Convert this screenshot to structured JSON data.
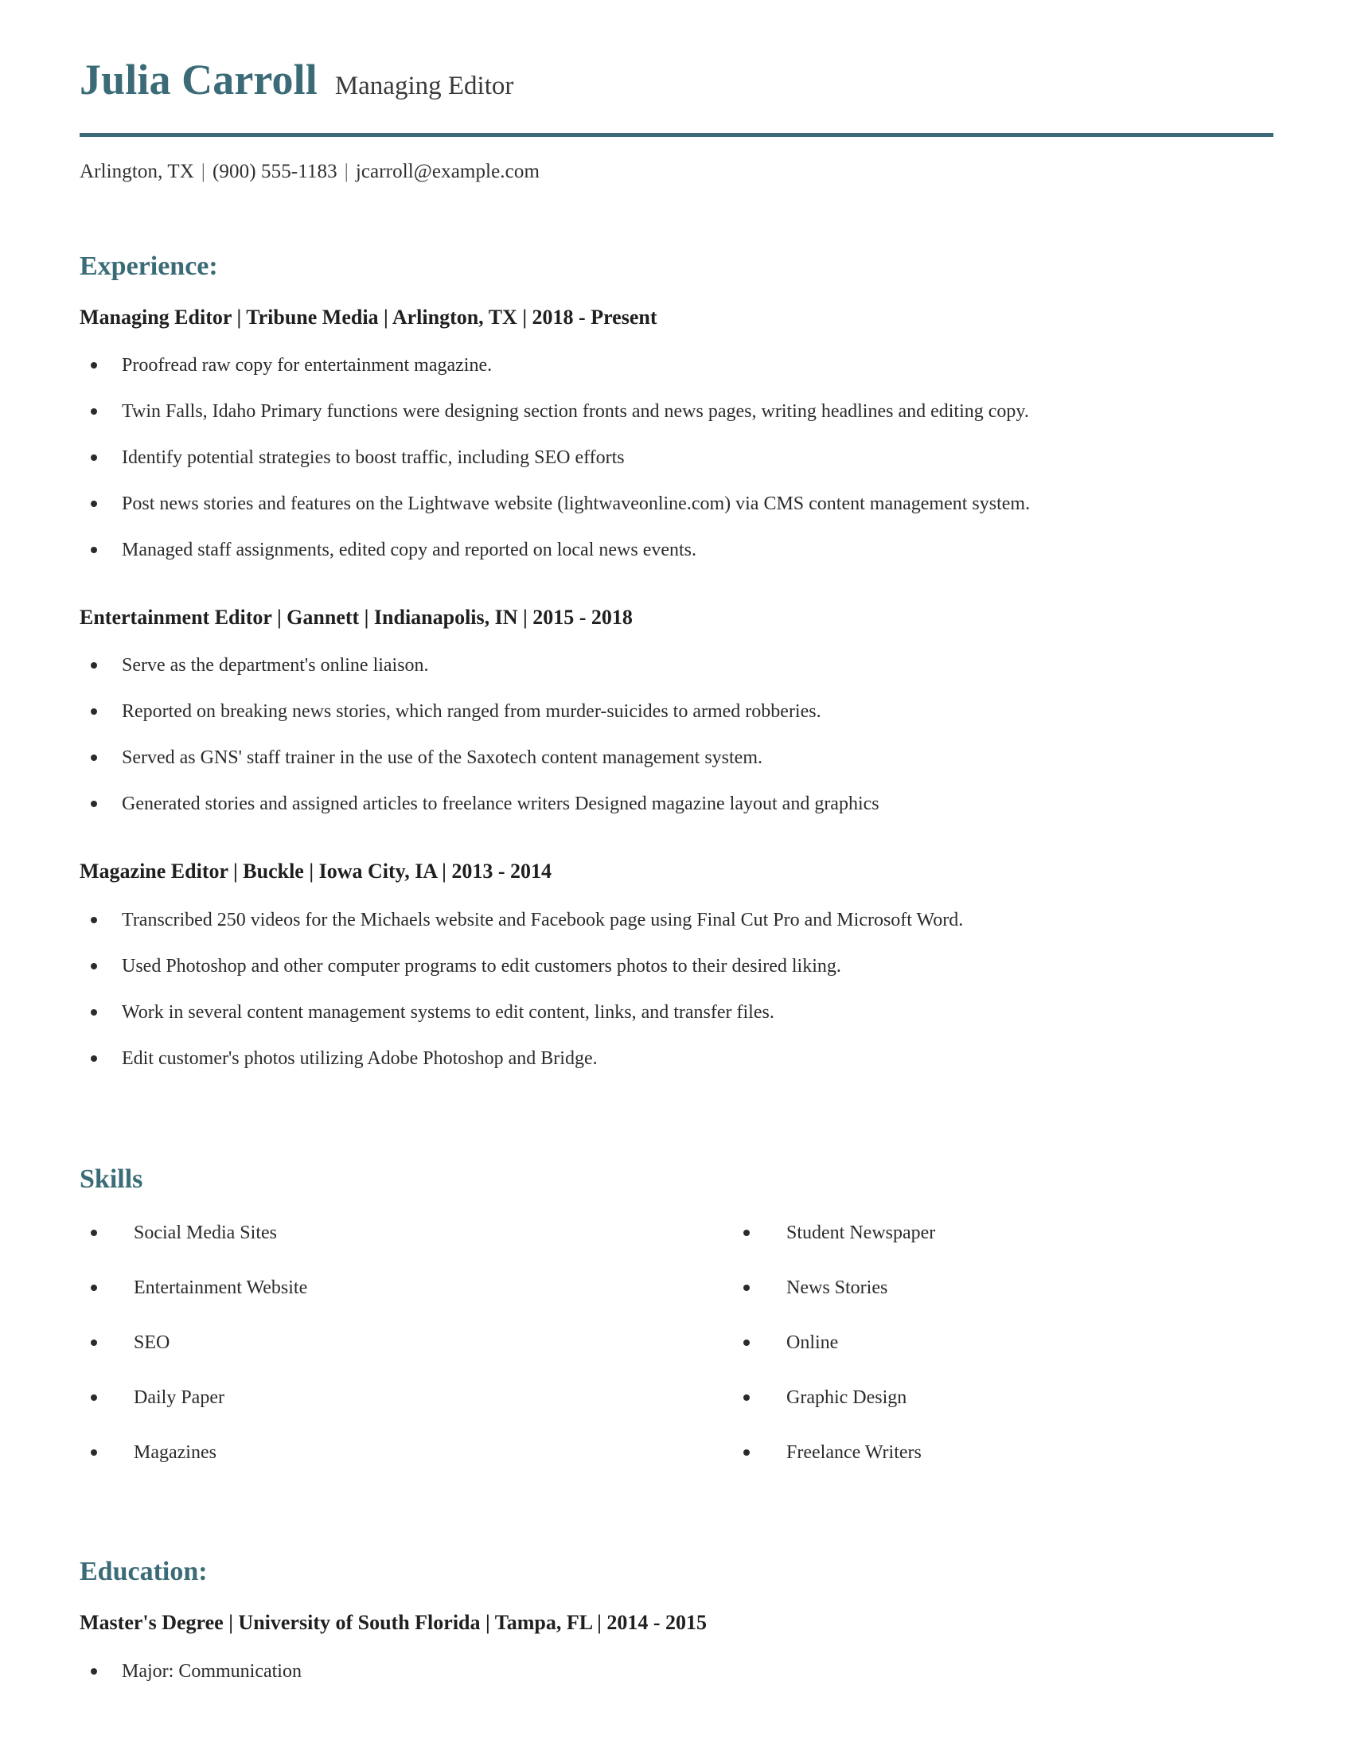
{
  "colors": {
    "accent": "#3a6b77",
    "text": "#2b2b2b",
    "heading_text": "#1f1f1f"
  },
  "header": {
    "name": "Julia Carroll",
    "job_title": "Managing Editor",
    "contact": {
      "location": "Arlington, TX",
      "phone": "(900) 555-1183",
      "email": "jcarroll@example.com",
      "separator": "|"
    }
  },
  "experience": {
    "heading": "Experience:",
    "entries": [
      {
        "heading": "Managing Editor | Tribune Media | Arlington, TX | 2018 - Present",
        "bullets": [
          "Proofread raw copy for entertainment magazine.",
          "Twin Falls, Idaho Primary functions were designing section fronts and news pages, writing headlines and editing copy.",
          "Identify potential strategies to boost traffic, including SEO efforts",
          "Post news stories and features on the Lightwave website (lightwaveonline.com) via CMS content management system.",
          "Managed staff assignments, edited copy and reported on local news events."
        ]
      },
      {
        "heading": "Entertainment Editor | Gannett | Indianapolis, IN | 2015 - 2018",
        "bullets": [
          "Serve as the department's online liaison.",
          "Reported on breaking news stories, which ranged from murder-suicides to armed robberies.",
          "Served as GNS' staff trainer in the use of the Saxotech content management system.",
          "Generated stories and assigned articles to freelance writers Designed magazine layout and graphics"
        ]
      },
      {
        "heading": "Magazine Editor | Buckle | Iowa City, IA | 2013 - 2014",
        "bullets": [
          "Transcribed 250 videos for the Michaels website and Facebook page using Final Cut Pro and Microsoft Word.",
          "Used Photoshop and other computer programs to edit customers photos to their desired liking.",
          "Work in several content management systems to edit content, links, and transfer files.",
          "Edit customer's photos utilizing Adobe Photoshop and Bridge."
        ]
      }
    ]
  },
  "skills": {
    "heading": "Skills",
    "left_column": [
      "Social Media Sites",
      "Entertainment Website",
      "SEO",
      "Daily Paper",
      "Magazines"
    ],
    "right_column": [
      "Student Newspaper",
      "News Stories",
      "Online",
      "Graphic Design",
      "Freelance Writers"
    ]
  },
  "education": {
    "heading": "Education:",
    "entries": [
      {
        "heading": "Master's Degree | University of South Florida | Tampa, FL | 2014 - 2015",
        "bullets": [
          "Major: Communication"
        ]
      }
    ]
  }
}
